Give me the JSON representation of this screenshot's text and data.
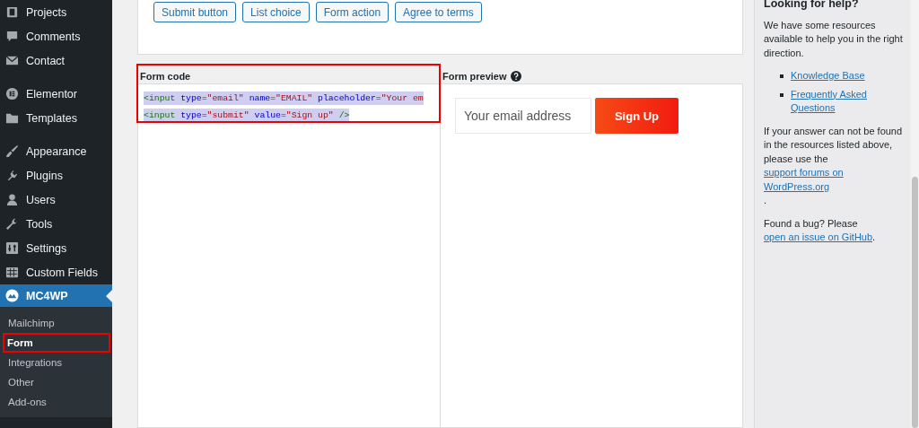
{
  "sidebar": {
    "groups": [
      [
        {
          "label": "Projects",
          "selected": false
        },
        {
          "label": "Comments",
          "selected": false
        },
        {
          "label": "Contact",
          "selected": false
        }
      ],
      [
        {
          "label": "Elementor",
          "selected": false
        },
        {
          "label": "Templates",
          "selected": false
        }
      ],
      [
        {
          "label": "Appearance",
          "selected": false
        },
        {
          "label": "Plugins",
          "selected": false
        },
        {
          "label": "Users",
          "selected": false
        },
        {
          "label": "Tools",
          "selected": false
        },
        {
          "label": "Settings",
          "selected": false
        },
        {
          "label": "Custom Fields",
          "selected": false
        },
        {
          "label": "MC4WP",
          "selected": true,
          "expanded": true,
          "children": [
            {
              "label": "Mailchimp",
              "selected": false,
              "highlighted": false
            },
            {
              "label": "Form",
              "selected": true,
              "highlighted": true
            },
            {
              "label": "Integrations",
              "selected": false,
              "highlighted": false
            },
            {
              "label": "Other",
              "selected": false,
              "highlighted": false
            },
            {
              "label": "Add-ons",
              "selected": false,
              "highlighted": false
            }
          ]
        }
      ]
    ]
  },
  "field_buttons": [
    "Submit button",
    "List choice",
    "Form action",
    "Agree to terms"
  ],
  "form_code": {
    "label": "Form code",
    "highlighted": true,
    "selected": true,
    "lines": [
      "<input type=\"email\" name=\"EMAIL\" placeholder=\"Your em",
      "<input type=\"submit\" value=\"Sign up\" />"
    ]
  },
  "form_preview": {
    "label": "Form preview",
    "email_placeholder": "Your email address",
    "button": "Sign Up"
  },
  "help": {
    "title": "Looking for help?",
    "intro": "We have some resources available to help you in the right direction.",
    "links": [
      "Knowledge Base",
      "Frequently Asked Questions"
    ],
    "paragraphs": [
      {
        "text": "If your answer can not be found in the resources listed above, please use the ",
        "link": "support forums on WordPress.org",
        "after": "."
      },
      {
        "text": "Found a bug? Please ",
        "link": "open an issue on GitHub",
        "after": "."
      }
    ]
  }
}
